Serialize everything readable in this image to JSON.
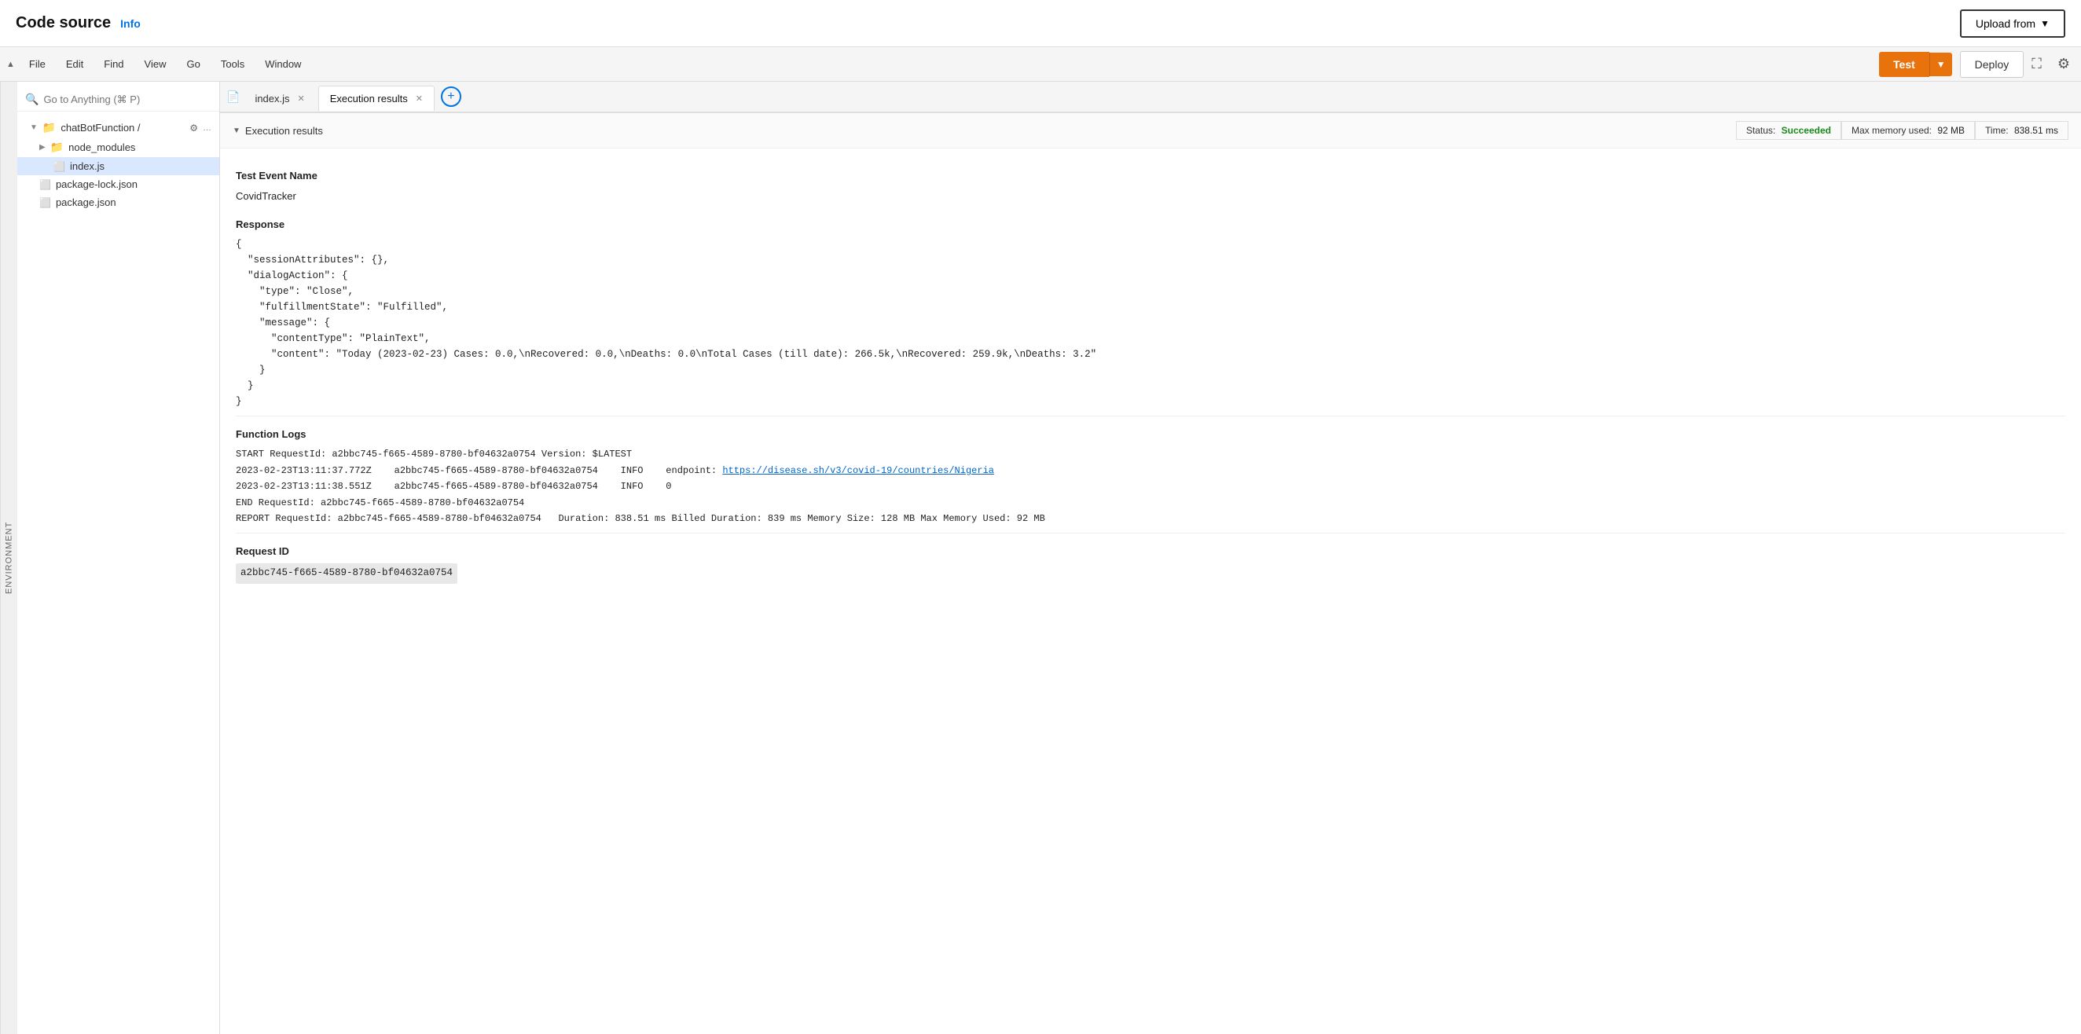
{
  "header": {
    "title": "Code source",
    "info_label": "Info",
    "upload_btn_label": "Upload from"
  },
  "menubar": {
    "items": [
      "File",
      "Edit",
      "Find",
      "View",
      "Go",
      "Tools",
      "Window"
    ],
    "test_btn": "Test",
    "deploy_btn": "Deploy"
  },
  "sidebar": {
    "env_label": "Environment",
    "search_placeholder": "Go to Anything (⌘ P)",
    "tree": [
      {
        "type": "folder",
        "label": "chatBotFunction /",
        "indent": 1,
        "expanded": true,
        "has_gear": true
      },
      {
        "type": "folder",
        "label": "node_modules",
        "indent": 2,
        "expanded": false
      },
      {
        "type": "file",
        "label": "index.js",
        "indent": 3,
        "active": true
      },
      {
        "type": "file",
        "label": "package-lock.json",
        "indent": 2
      },
      {
        "type": "file",
        "label": "package.json",
        "indent": 2
      }
    ]
  },
  "tabs": [
    {
      "label": "index.js",
      "closable": true
    },
    {
      "label": "Execution results",
      "closable": true,
      "active": true
    }
  ],
  "execution": {
    "panel_title": "Execution results",
    "status_label": "Status:",
    "status_value": "Succeeded",
    "memory_label": "Max memory used:",
    "memory_value": "92 MB",
    "time_label": "Time:",
    "time_value": "838.51 ms",
    "test_event_title": "Test Event Name",
    "test_event_name": "CovidTracker",
    "response_title": "Response",
    "response_json": "{\n  \"sessionAttributes\": {},\n  \"dialogAction\": {\n    \"type\": \"Close\",\n    \"fulfillmentState\": \"Fulfilled\",\n    \"message\": {\n      \"contentType\": \"PlainText\",\n      \"content\": \"Today (2023-02-23) Cases: 0.0,\\nRecovered: 0.0,\\nDeaths: 0.0\\nTotal Cases (till date): 266.5k,\\nRecovered: 259.9k,\\nDeaths: 3.2\"\n    }\n  }\n}",
    "logs_title": "Function Logs",
    "log_line1": "START RequestId: a2bbc745-f665-4589-8780-bf04632a0754 Version: $LATEST",
    "log_line2": "2023-02-23T13:11:37.772Z    a2bbc745-f665-4589-8780-bf04632a0754    INFO    endpoint: https://disease.sh/v3/covid-19/countries/Nigeria",
    "log_line2_url": "https://disease.sh/v3/covid-19/countries/Nigeria",
    "log_line3": "2023-02-23T13:11:38.551Z    a2bbc745-f665-4589-8780-bf04632a0754    INFO    0",
    "log_line4": "END RequestId: a2bbc745-f665-4589-8780-bf04632a0754",
    "log_line5": "REPORT RequestId: a2bbc745-f665-4589-8780-bf04632a0754   Duration: 838.51 ms Billed Duration: 839 ms Memory Size: 128 MB Max Memory Used: 92 MB",
    "request_id_title": "Request ID",
    "request_id_value": "a2bbc745-f665-4589-8780-bf04632a0754"
  }
}
